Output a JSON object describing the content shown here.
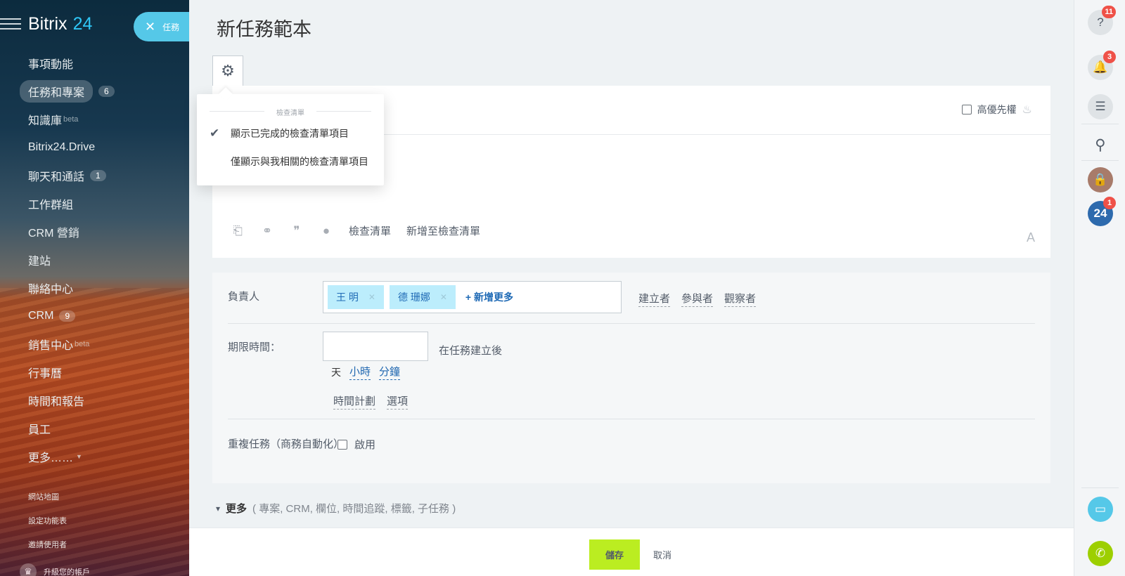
{
  "app": {
    "logo_text": "Bitrix",
    "logo_num": "24",
    "tasks_pill": "任務"
  },
  "sidebar": {
    "items": [
      {
        "label": "事項動能",
        "sup": "",
        "count": ""
      },
      {
        "label": "任務和專案",
        "sup": "",
        "count": "6",
        "active": true
      },
      {
        "label": "知識庫",
        "sup": "beta",
        "count": ""
      },
      {
        "label": "Bitrix24.Drive",
        "sup": "",
        "count": ""
      },
      {
        "label": "聊天和通話",
        "sup": "",
        "count": "1"
      },
      {
        "label": "工作群組",
        "sup": "",
        "count": ""
      },
      {
        "label": "CRM 營銷",
        "sup": "",
        "count": ""
      },
      {
        "label": "建站",
        "sup": "",
        "count": ""
      },
      {
        "label": "聯絡中心",
        "sup": "",
        "count": ""
      },
      {
        "label": "CRM",
        "sup": "",
        "count": "9"
      },
      {
        "label": "銷售中心",
        "sup": "beta",
        "count": ""
      },
      {
        "label": "行事曆",
        "sup": "",
        "count": ""
      },
      {
        "label": "時間和報告",
        "sup": "",
        "count": ""
      },
      {
        "label": "員工",
        "sup": "",
        "count": ""
      },
      {
        "label": "更多……",
        "sup": "",
        "count": ""
      }
    ],
    "submenu": [
      "網站地圖",
      "設定功能表",
      "邀請使用者"
    ],
    "upgrade": "升級您的帳戶"
  },
  "page": {
    "title": "新任務範本"
  },
  "checklist_popup": {
    "header": "檢查清單",
    "options": [
      {
        "label": "顯示已完成的檢查清單項目",
        "checked": true
      },
      {
        "label": "僅顯示與我相關的檢查清單項目",
        "checked": false
      }
    ]
  },
  "editor": {
    "high_priority": "高優先權",
    "toolbar": {
      "checklist": "檢查清單",
      "add_to_checklist": "新增至檢查清單"
    },
    "font_icon": "A"
  },
  "props": {
    "responsible_label": "負責人",
    "responsible": [
      "王 明",
      "德 珊娜"
    ],
    "add_more": "+ 新增更多",
    "roles": [
      "建立者",
      "參與者",
      "觀察者"
    ],
    "deadline_label": "期限時間：",
    "deadline_value": "",
    "after_creation": "在任務建立後",
    "units": {
      "day": "天",
      "hour": "小時",
      "minute": "分鐘"
    },
    "plan_links": [
      "時間計劃",
      "選項"
    ],
    "repeat_label": "重複任務（商務自動化）",
    "enable": "啟用"
  },
  "more": {
    "label": "更多",
    "sub": "( 專案, CRM, 欄位, 時間追蹤, 標籤, 子任務 )"
  },
  "actions": {
    "save": "儲存",
    "cancel": "取消"
  },
  "rightbar": {
    "help_badge": "11",
    "bell_badge": "3",
    "b24_badge": "1",
    "b24_label": "24"
  }
}
